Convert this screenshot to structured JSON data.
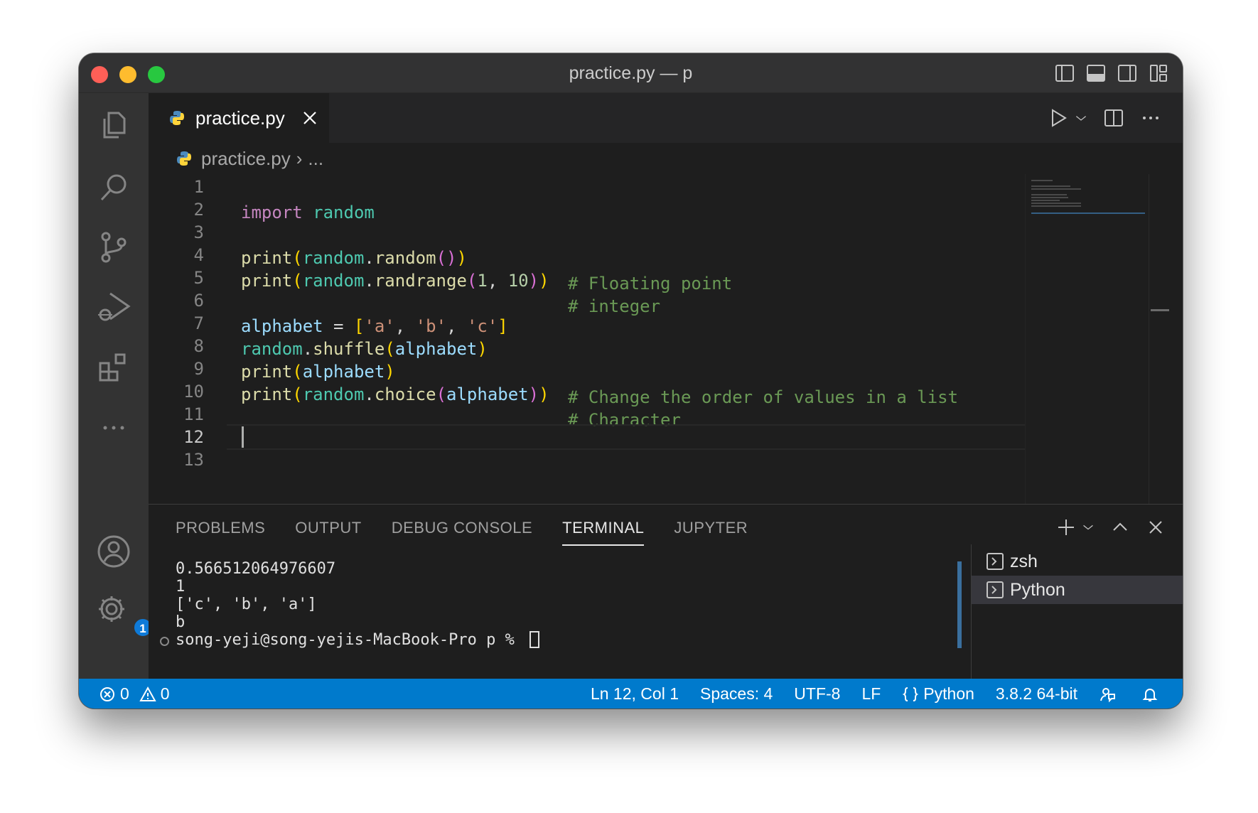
{
  "window": {
    "title": "practice.py — p"
  },
  "tab": {
    "label": "practice.py"
  },
  "breadcrumb": {
    "file": "practice.py",
    "more": "..."
  },
  "editor": {
    "line_numbers": [
      "1",
      "2",
      "3",
      "4",
      "5",
      "6",
      "7",
      "8",
      "9",
      "10",
      "11",
      "12",
      "13"
    ],
    "active_line": "12",
    "lines": {
      "l1": {
        "import": "import",
        "mod": "random"
      },
      "l3": {
        "fn": "print",
        "mod": "random",
        "method": "random",
        "comment": "# Floating point"
      },
      "l4": {
        "fn": "print",
        "mod": "random",
        "method": "randrange",
        "arg1": "1",
        "arg2": "10",
        "comment": "# integer"
      },
      "l6": {
        "var": "alphabet",
        "s1": "'a'",
        "s2": "'b'",
        "s3": "'c'"
      },
      "l7": {
        "mod": "random",
        "method": "shuffle",
        "arg": "alphabet"
      },
      "l8": {
        "fn": "print",
        "arg": "alphabet",
        "comment": "# Change the order of values in a list"
      },
      "l9": {
        "fn": "print",
        "mod": "random",
        "method": "choice",
        "arg": "alphabet",
        "comment": "# Character"
      }
    }
  },
  "panel": {
    "tabs": [
      "PROBLEMS",
      "OUTPUT",
      "DEBUG CONSOLE",
      "TERMINAL",
      "JUPYTER"
    ],
    "active_tab": "TERMINAL",
    "terminal_lines": [
      "0.566512064976607",
      "1",
      "['c', 'b', 'a']",
      "b"
    ],
    "prompt": "song-yeji@song-yejis-MacBook-Pro p % ",
    "terminals": [
      "zsh",
      "Python"
    ],
    "selected_terminal": "Python"
  },
  "activity": {
    "settings_badge": "1"
  },
  "statusbar": {
    "errors": "0",
    "warnings": "0",
    "position": "Ln 12, Col 1",
    "spaces": "Spaces: 4",
    "encoding": "UTF-8",
    "eol": "LF",
    "language": "Python",
    "interpreter": "3.8.2 64-bit"
  },
  "colors": {
    "statusbar": "#007acc",
    "editor_bg": "#1e1e1e",
    "activitybar": "#333333"
  }
}
